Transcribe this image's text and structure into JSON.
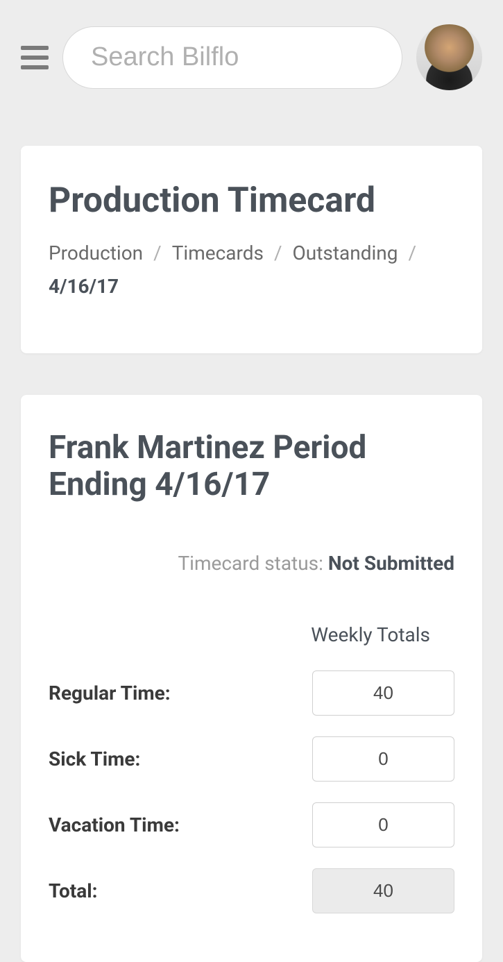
{
  "header": {
    "search_placeholder": "Search Bilflo"
  },
  "card1": {
    "title": "Production Timecard",
    "breadcrumb": {
      "item1": "Production",
      "item2": "Timecards",
      "item3": "Outstanding",
      "current": "4/16/17"
    }
  },
  "card2": {
    "title": "Frank Martinez Period Ending 4/16/17",
    "status_label": "Timecard status: ",
    "status_value": "Not Submitted",
    "totals_header": "Weekly Totals",
    "rows": {
      "regular": {
        "label": "Regular Time:",
        "value": "40"
      },
      "sick": {
        "label": "Sick Time:",
        "value": "0"
      },
      "vacation": {
        "label": "Vacation Time:",
        "value": "0"
      },
      "total": {
        "label": "Total:",
        "value": "40"
      }
    }
  }
}
